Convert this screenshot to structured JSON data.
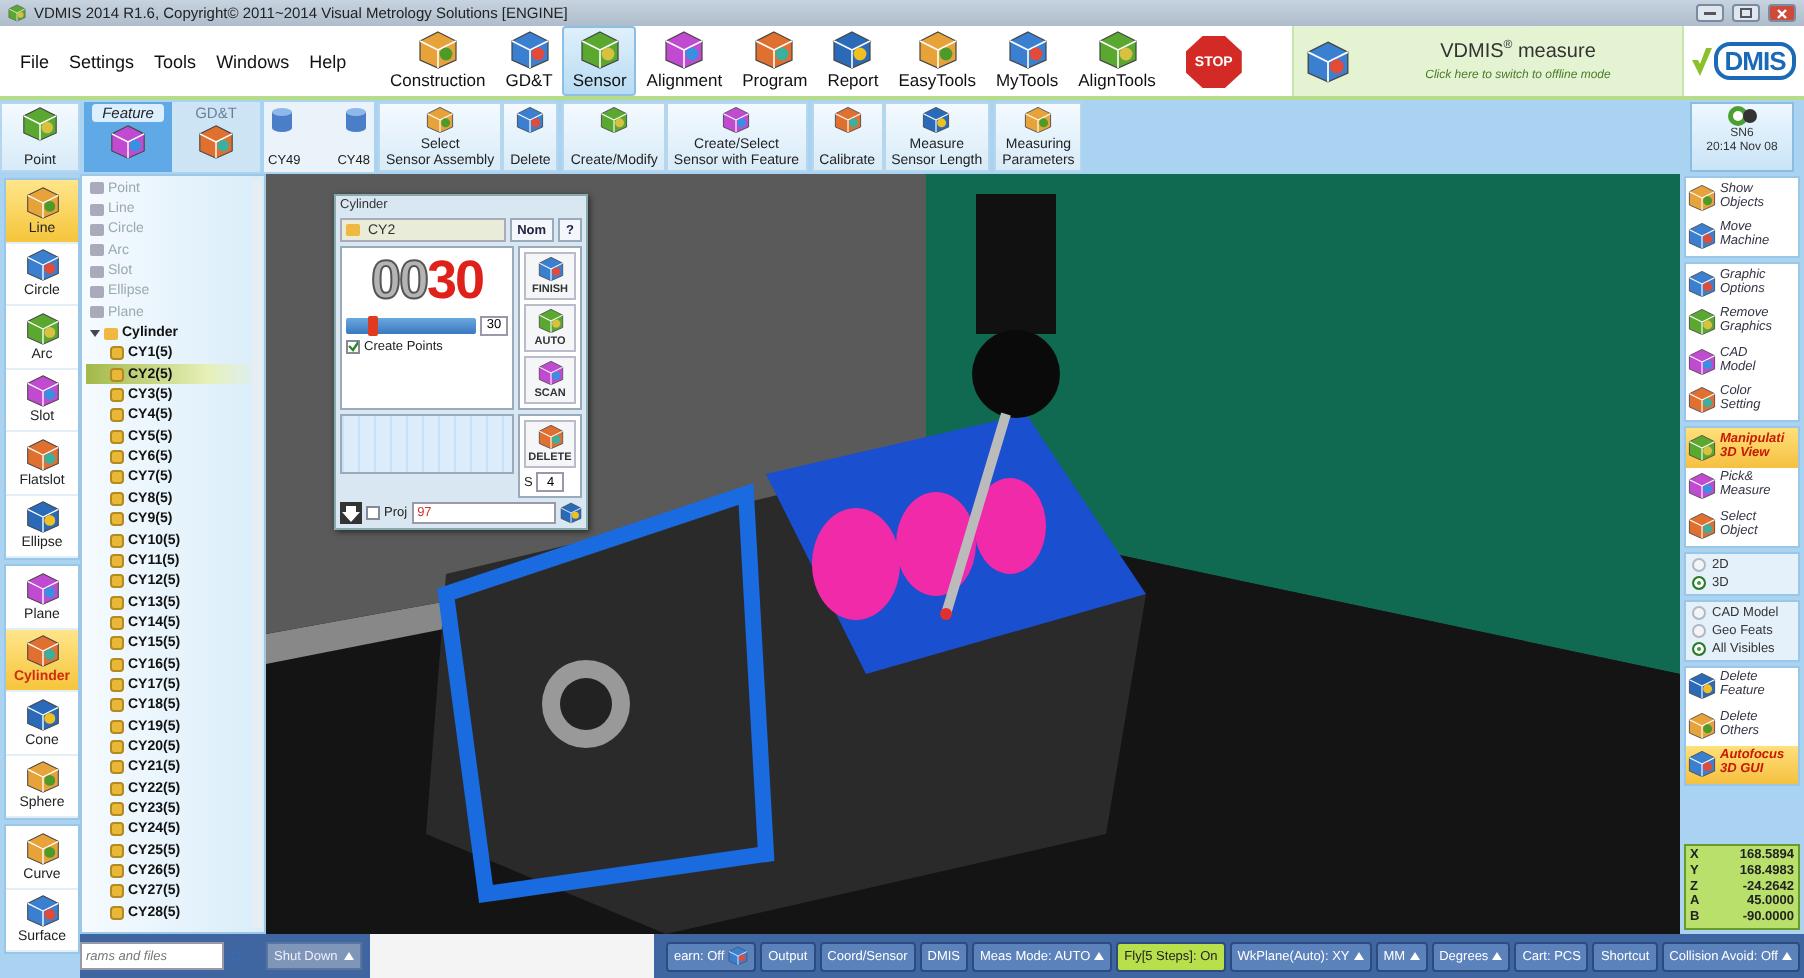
{
  "window": {
    "title": "VDMIS 2014 R1.6, Copyright© 2011~2014 Visual Metrology Solutions [ENGINE]"
  },
  "menu": [
    "File",
    "Settings",
    "Tools",
    "Windows",
    "Help"
  ],
  "ribbon": [
    {
      "label": "Construction",
      "selected": false
    },
    {
      "label": "GD&T",
      "selected": false
    },
    {
      "label": "Sensor",
      "selected": true
    },
    {
      "label": "Alignment",
      "selected": false
    },
    {
      "label": "Program",
      "selected": false
    },
    {
      "label": "Report",
      "selected": false
    },
    {
      "label": "EasyTools",
      "selected": false
    },
    {
      "label": "MyTools",
      "selected": false
    },
    {
      "label": "AlignTools",
      "selected": false
    }
  ],
  "stop": "STOP",
  "brand": {
    "title": "VDMIS$^{®}$ measure",
    "subtitle": "Click here to switch to offline mode",
    "logo": "DMIS"
  },
  "toolbar": {
    "point": "Point",
    "feature_tabs": [
      {
        "label": "Feature",
        "selected": true
      },
      {
        "label": "GD&T",
        "selected": false
      }
    ],
    "recent": [
      "CY49",
      "CY48"
    ],
    "action_groups": [
      [
        "Select\nSensor Assembly",
        "Delete"
      ],
      [
        "Create/Modify",
        "Create/Select\nSensor with Feature"
      ],
      [
        "Calibrate",
        "Measure\nSensor Length"
      ],
      [
        "Measuring\nParameters"
      ]
    ],
    "status": {
      "name": "SN6",
      "time": "20:14 Nov 08"
    }
  },
  "feature_types": [
    [
      {
        "label": "Line",
        "selected": true
      },
      {
        "label": "Circle",
        "selected": false
      },
      {
        "label": "Arc",
        "selected": false
      },
      {
        "label": "Slot",
        "selected": false
      },
      {
        "label": "Flatslot",
        "selected": false
      },
      {
        "label": "Ellipse",
        "selected": false
      }
    ],
    [
      {
        "label": "Plane",
        "selected": false
      },
      {
        "label": "Cylinder",
        "selected": true
      },
      {
        "label": "Cone",
        "selected": false
      },
      {
        "label": "Sphere",
        "selected": false
      }
    ],
    [
      {
        "label": "Curve",
        "selected": false
      },
      {
        "label": "Surface",
        "selected": false
      }
    ]
  ],
  "tree": [
    {
      "label": "Point",
      "disabled": true
    },
    {
      "label": "Line",
      "disabled": true
    },
    {
      "label": "Circle",
      "disabled": true
    },
    {
      "label": "Arc",
      "disabled": true
    },
    {
      "label": "Slot",
      "disabled": true
    },
    {
      "label": "Ellipse",
      "disabled": true
    },
    {
      "label": "Plane",
      "disabled": true
    },
    {
      "label": "Cylinder",
      "disabled": false,
      "expanded": true,
      "children": [
        {
          "label": "CY1(5)",
          "selected": false
        },
        {
          "label": "CY2(5)",
          "selected": true
        },
        {
          "label": "CY3(5)",
          "selected": false
        },
        {
          "label": "CY4(5)",
          "selected": false
        },
        {
          "label": "CY5(5)",
          "selected": false
        },
        {
          "label": "CY6(5)",
          "selected": false
        },
        {
          "label": "CY7(5)",
          "selected": false
        },
        {
          "label": "CY8(5)",
          "selected": false
        },
        {
          "label": "CY9(5)",
          "selected": false
        },
        {
          "label": "CY10(5)",
          "selected": false
        },
        {
          "label": "CY11(5)",
          "selected": false
        },
        {
          "label": "CY12(5)",
          "selected": false
        },
        {
          "label": "CY13(5)",
          "selected": false
        },
        {
          "label": "CY14(5)",
          "selected": false
        },
        {
          "label": "CY15(5)",
          "selected": false
        },
        {
          "label": "CY16(5)",
          "selected": false
        },
        {
          "label": "CY17(5)",
          "selected": false
        },
        {
          "label": "CY18(5)",
          "selected": false
        },
        {
          "label": "CY19(5)",
          "selected": false
        },
        {
          "label": "CY20(5)",
          "selected": false
        },
        {
          "label": "CY21(5)",
          "selected": false
        },
        {
          "label": "CY22(5)",
          "selected": false
        },
        {
          "label": "CY23(5)",
          "selected": false
        },
        {
          "label": "CY24(5)",
          "selected": false
        },
        {
          "label": "CY25(5)",
          "selected": false
        },
        {
          "label": "CY26(5)",
          "selected": false
        },
        {
          "label": "CY27(5)",
          "selected": false
        },
        {
          "label": "CY28(5)",
          "selected": false
        }
      ]
    }
  ],
  "search": {
    "placeholder": "rams and files"
  },
  "shutdown": "Shut Down",
  "dialog": {
    "title": "Cylinder",
    "name": "CY2",
    "nom": "Nom",
    "help": "?",
    "counter_dim": "00",
    "counter_value": "30",
    "slider": {
      "level": 0.2,
      "value": "30"
    },
    "create_points": {
      "label": "Create Points",
      "checked": true
    },
    "buttons": [
      "FINISH",
      "AUTO",
      "SCAN"
    ],
    "delete": "DELETE",
    "s_label": "S",
    "s_value": "4",
    "proj": {
      "label": "Proj",
      "checked": false,
      "value": "97"
    }
  },
  "right_panel": [
    {
      "kind": "buttons",
      "items": [
        {
          "label": "Show\nObjects",
          "active": false
        },
        {
          "label": "Move\nMachine",
          "active": false
        }
      ]
    },
    {
      "kind": "buttons",
      "items": [
        {
          "label": "Graphic\nOptions",
          "active": false
        },
        {
          "label": "Remove\nGraphics",
          "active": false
        },
        {
          "label": "CAD\nModel",
          "active": false
        },
        {
          "label": "Color\nSetting",
          "active": false
        }
      ]
    },
    {
      "kind": "buttons",
      "items": [
        {
          "label": "Manipulati\n3D View",
          "active": true
        },
        {
          "label": "Pick&\nMeasure",
          "active": false
        },
        {
          "label": "Select\nObject",
          "active": false
        }
      ]
    },
    {
      "kind": "radios",
      "items": [
        {
          "label": "2D",
          "selected": false
        },
        {
          "label": "3D",
          "selected": true
        }
      ]
    },
    {
      "kind": "radios",
      "items": [
        {
          "label": "CAD Model",
          "selected": false
        },
        {
          "label": "Geo Feats",
          "selected": false
        },
        {
          "label": "All Visibles",
          "selected": true
        }
      ]
    },
    {
      "kind": "buttons",
      "items": [
        {
          "label": "Delete\nFeature",
          "active": false
        },
        {
          "label": "Delete\nOthers",
          "active": false
        },
        {
          "label": "Autofocus\n3D GUI",
          "active": true
        }
      ]
    }
  ],
  "coordinates": [
    {
      "axis": "X",
      "value": "168.5894"
    },
    {
      "axis": "Y",
      "value": "168.4983"
    },
    {
      "axis": "Z",
      "value": "-24.2642"
    },
    {
      "axis": "A",
      "value": "45.0000"
    },
    {
      "axis": "B",
      "value": "-90.0000"
    }
  ],
  "status_bar": [
    {
      "label": "earn: Off",
      "menu": false,
      "highlighted": false,
      "icon": true
    },
    {
      "label": "Output",
      "menu": false,
      "highlighted": false,
      "icon": false
    },
    {
      "label": "Coord/Sensor",
      "menu": false,
      "highlighted": false,
      "icon": false
    },
    {
      "label": "DMIS",
      "menu": false,
      "highlighted": false,
      "icon": false
    },
    {
      "label": "Meas Mode: AUTO",
      "menu": true,
      "highlighted": false,
      "icon": false
    },
    {
      "label": "Fly[5 Steps]: On",
      "menu": false,
      "highlighted": true,
      "icon": false
    },
    {
      "label": "WkPlane(Auto): XY",
      "menu": true,
      "highlighted": false,
      "icon": false
    },
    {
      "label": "MM",
      "menu": true,
      "highlighted": false,
      "icon": false
    },
    {
      "label": "Degrees",
      "menu": true,
      "highlighted": false,
      "icon": false
    },
    {
      "label": "Cart: PCS",
      "menu": false,
      "highlighted": false,
      "icon": false
    },
    {
      "label": "Shortcut",
      "menu": false,
      "highlighted": false,
      "icon": false
    },
    {
      "label": "Collision Avoid: Off",
      "menu": true,
      "highlighted": false,
      "icon": false
    }
  ]
}
